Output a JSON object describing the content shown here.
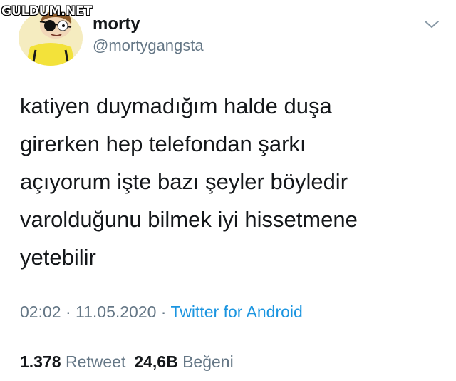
{
  "watermark": "GULDUM.NET",
  "user": {
    "display_name": "morty",
    "handle": "@mortygangsta"
  },
  "icons": {
    "menu": "chevron-down-icon"
  },
  "tweet": {
    "text": "katiyen duymadığım halde duşa\ngirerken hep telefondan şarkı\naçıyorum işte bazı şeyler böyledir\nvarolduğunu bilmek iyi hissetmene\nyetebilir",
    "time": "02:02",
    "separator_1": " · ",
    "date": "11.05.2020",
    "separator_2": " · ",
    "source": "Twitter for Android"
  },
  "stats": {
    "retweets_count": "1.378",
    "retweets_label": "Retweet",
    "likes_count": "24,6B",
    "likes_label": "Beğeni"
  },
  "colors": {
    "text_primary": "#14171a",
    "text_secondary": "#657786",
    "link": "#1b95e0",
    "divider": "#e1e8ed"
  }
}
